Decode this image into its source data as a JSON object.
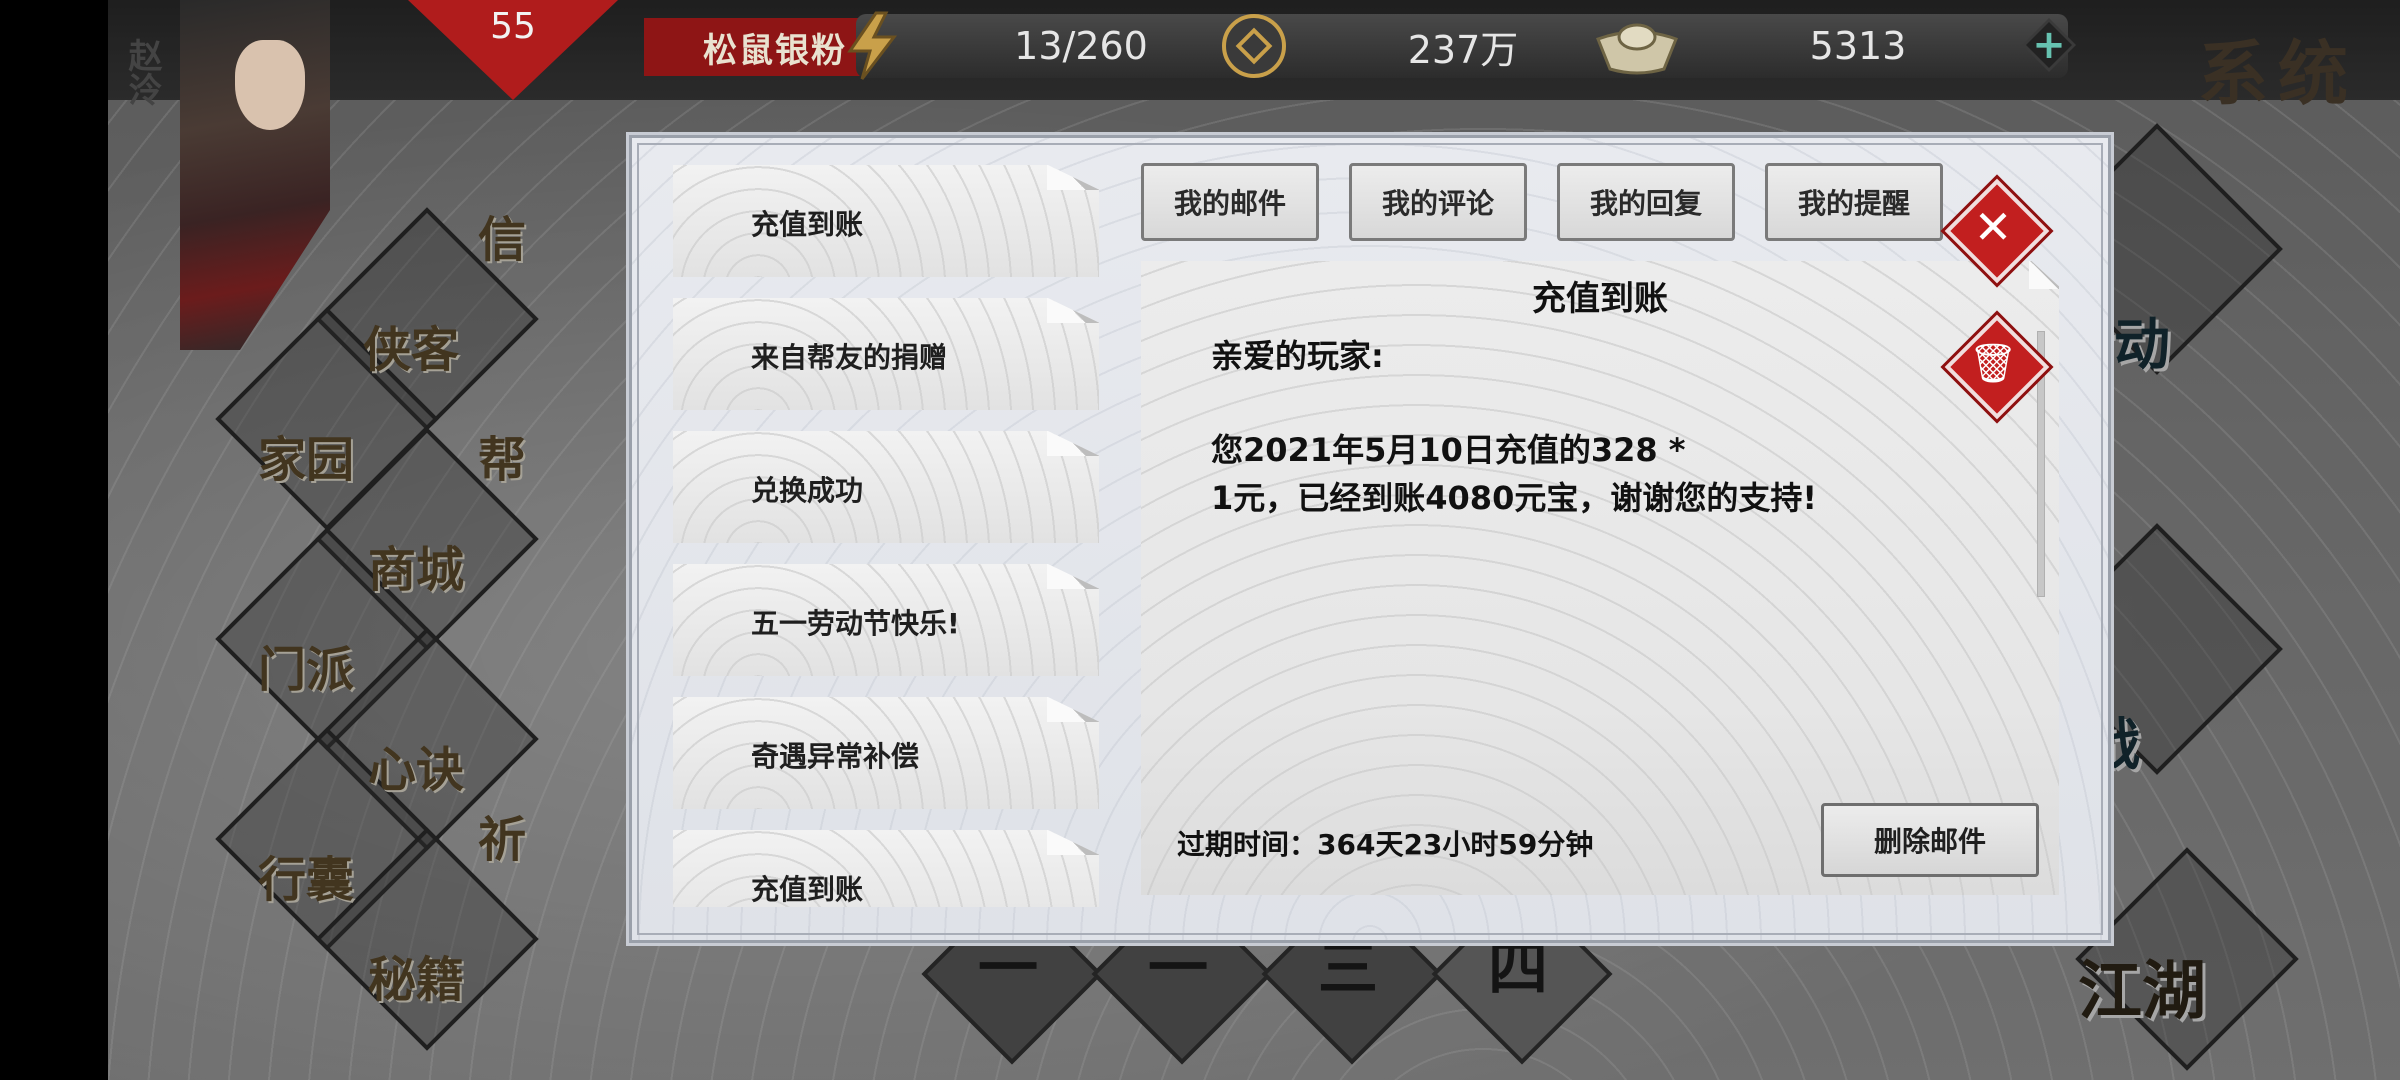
{
  "player": {
    "name": "赵泠",
    "level": "55",
    "server": "松鼠银粉"
  },
  "resources": {
    "energy": {
      "value": "13/260",
      "icon": "lightning-icon"
    },
    "coins": {
      "value": "237万",
      "icon": "copper-coin-icon"
    },
    "ingots": {
      "value": "5313",
      "icon": "gold-ingot-icon"
    },
    "plus": "+"
  },
  "system_menu": {
    "label": "系统"
  },
  "left_menu": {
    "items": [
      "侠客",
      "家园",
      "帮",
      "商城",
      "门派",
      "心诀",
      "行囊",
      "秘籍",
      "信",
      "祈"
    ]
  },
  "right_menu": {
    "activity": "活动",
    "battle": "对战",
    "jianghu": "江湖"
  },
  "chapters": [
    "一",
    "一",
    "三",
    "四"
  ],
  "mail_dialog": {
    "tabs": [
      "我的邮件",
      "我的评论",
      "我的回复",
      "我的提醒"
    ],
    "mail_list": [
      "充值到账",
      "来自帮友的捐赠",
      "兑换成功",
      "五一劳动节快乐!",
      "奇遇异常补偿",
      "充值到账"
    ],
    "selected_mail": {
      "title": "充值到账",
      "greeting": "亲爱的玩家:",
      "body_line1": "您2021年5月10日充值的328 *",
      "body_line2": "1元，已经到账4080元宝，谢谢您的支持!",
      "expire": "过期时间：364天23小时59分钟",
      "delete_label": "删除邮件"
    },
    "close_symbol": "✕",
    "trash_symbol": "🗑"
  },
  "colors": {
    "accent_red": "#c21f1f",
    "server_red": "#8e1515",
    "plus_teal": "#66c2b0"
  }
}
